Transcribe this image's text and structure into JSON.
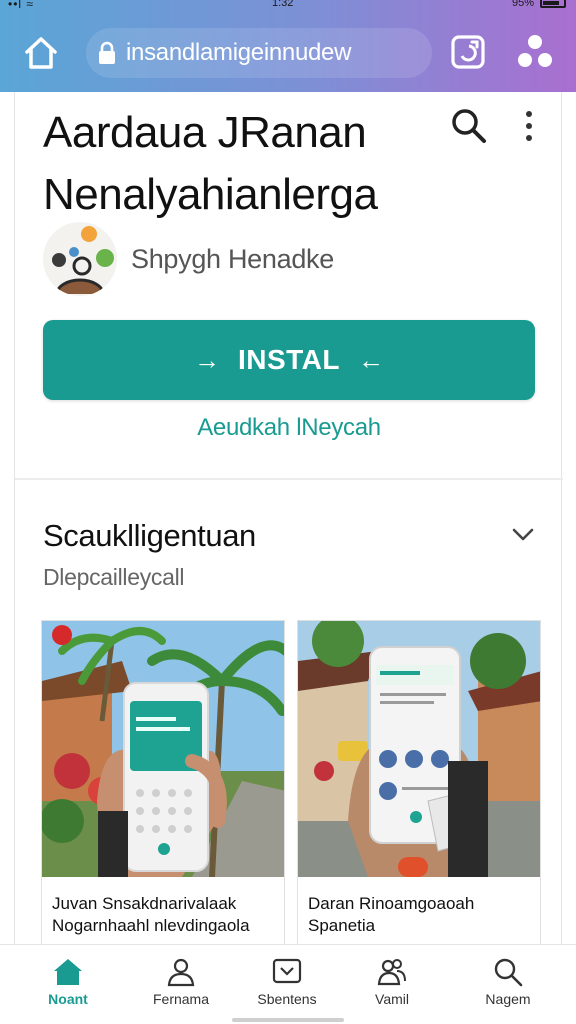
{
  "status_bar": {
    "left": "••l ≈",
    "center": "1:32",
    "right": "95%"
  },
  "browser": {
    "url": "insandlamigeinnudew",
    "home_icon": "home-icon",
    "lock_icon": "lock-icon",
    "tabs_icon": "tabs-icon",
    "menu_icon": "dots-menu-icon"
  },
  "app": {
    "title": "Aardaua JRanan Nenalyahianlerga",
    "developer": "Shpygh Henadke",
    "install_label": "INSTAL",
    "install_arrow_left": "→",
    "install_arrow_right": "←",
    "sub_link": "Aeudkah lNeycah"
  },
  "section": {
    "title": "Scauklligentuan",
    "subtitle": "Dlepcailleycall",
    "cards": [
      {
        "caption": "Juvan Snsakdnarivalaak Nogarnhaahl nlevdingaola"
      },
      {
        "caption": "Daran Rinoamgoaoah Spanetia"
      }
    ]
  },
  "bottom_nav": {
    "items": [
      {
        "label": "Noant",
        "icon": "home-icon",
        "active": true
      },
      {
        "label": "Fernama",
        "icon": "person-icon",
        "active": false
      },
      {
        "label": "Sbentens",
        "icon": "message-icon",
        "active": false
      },
      {
        "label": "Vamil",
        "icon": "people-icon",
        "active": false
      },
      {
        "label": "Nagem",
        "icon": "search-icon",
        "active": false
      }
    ]
  },
  "colors": {
    "accent": "#1a9b91",
    "gradient_start": "#5aa6d6",
    "gradient_end": "#a96fd0"
  }
}
